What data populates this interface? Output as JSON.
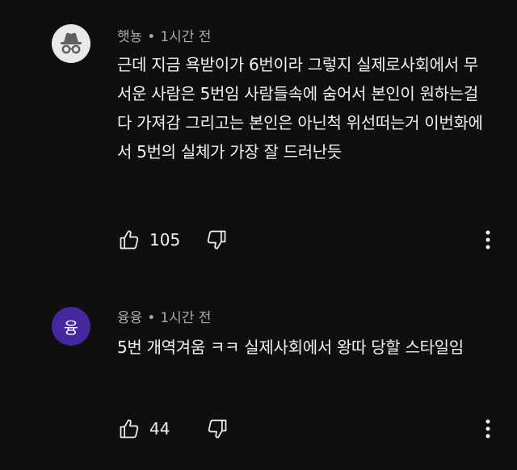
{
  "comments": [
    {
      "author": "햇뇽",
      "separator": "•",
      "time": "1시간 전",
      "avatar_icon": "incognito-icon",
      "avatar_letter": "",
      "text": "근데 지금 욕받이가 6번이라 그렇지 실제로사회에서 무서운 사람은 5번임 사람들속에 숨어서 본인이 원하는걸 다 가져감 그리고는 본인은 아닌척 위선떠는거 이번화에서 5번의 실체가 가장 잘 드러난듯",
      "likes": "105"
    },
    {
      "author": "융융",
      "separator": "•",
      "time": "1시간 전",
      "avatar_icon": "letter-avatar",
      "avatar_letter": "융",
      "avatar_color": "#4527a0",
      "text": "5번 개역겨움 ㅋㅋ 실제사회에서 왕따 당할 스타일임",
      "likes": "44"
    }
  ],
  "icons": {
    "like": "thumbs-up-icon",
    "dislike": "thumbs-down-icon",
    "more": "more-vertical-icon"
  }
}
